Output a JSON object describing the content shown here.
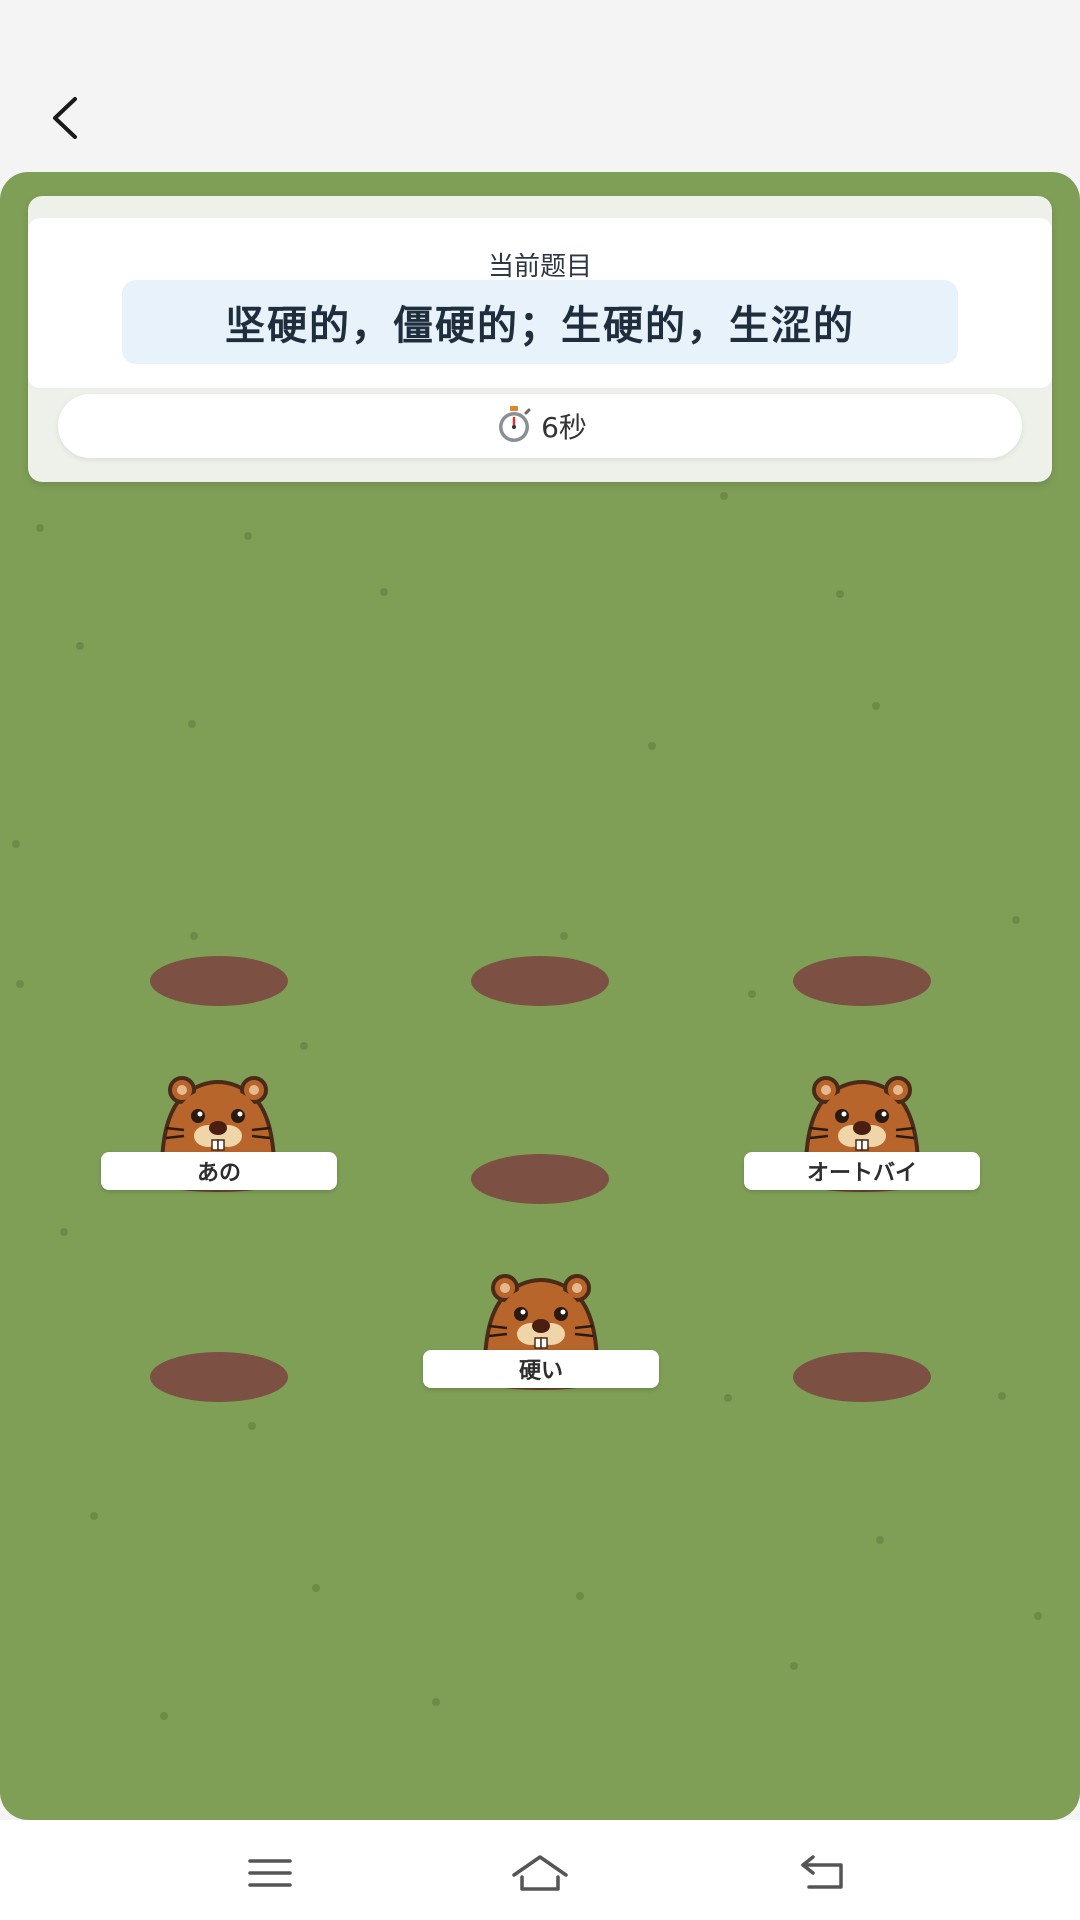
{
  "header": {
    "back_icon": "chevron-left-icon"
  },
  "question": {
    "label": "当前题目",
    "text": "坚硬的，僵硬的；生硬的，生涩的"
  },
  "timer": {
    "icon": "stopwatch-icon",
    "value": "6秒"
  },
  "moles": [
    {
      "label": "あの"
    },
    {
      "label": "オートバイ"
    },
    {
      "label": "硬い"
    }
  ],
  "colors": {
    "field": "#7f9f57",
    "hole": "#7c5143",
    "mole_fur": "#b8652b",
    "question_bg": "#e8f2fb"
  },
  "navbar": {
    "menu_icon": "menu-icon",
    "home_icon": "home-icon",
    "back_icon": "back-arrow-icon"
  }
}
